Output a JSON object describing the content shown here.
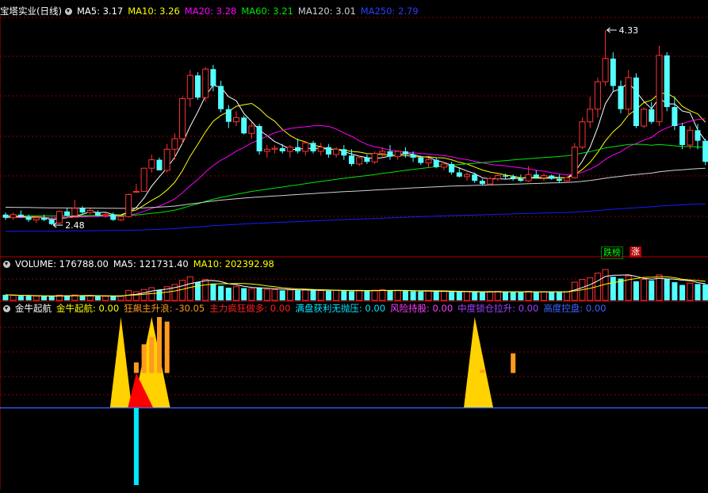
{
  "main_header": {
    "title": "宝塔实业(日线)",
    "ma5": "MA5: 3.17",
    "ma10": "MA10: 3.26",
    "ma20": "MA20: 3.28",
    "ma60": "MA60: 3.21",
    "ma120": "MA120: 3.01",
    "ma250": "MA250: 2.79"
  },
  "volume_header": {
    "title": "VOLUME: 176788.00",
    "ma5": "MA5: 121731.40",
    "ma10": "MA10: 202392.98"
  },
  "indicator_header": {
    "title": "金牛起航",
    "s1": "金牛起航: 0.00",
    "s2": "狂飙主升浪: -30.05",
    "s3": "主力疯狂做多: 0.00",
    "s4": "满盘获利无抛压: 0.00",
    "s5": "风险持股: 0.00",
    "s6": "中度锁仓拉升: 0.00",
    "s7": "高度控盘: 0.00"
  },
  "badges": {
    "drop_list": "跌榜",
    "rise": "涨"
  },
  "colors": {
    "up": "#ff3232",
    "down": "#54ffff",
    "ma5": "#ffffff",
    "ma10": "#ffff00",
    "ma20": "#ff00ff",
    "ma60": "#00e600",
    "ma120": "#d0d0d0",
    "ma250": "#1a1aff",
    "grid": "#8b0000",
    "yellow": "#ffd200",
    "red": "#ff0000",
    "orange": "#ff9a1e",
    "blue_line": "#3c64ff",
    "cyan": "#00e6ff"
  },
  "chart_data": [
    {
      "type": "candlestick",
      "title": "宝塔实业(日线)",
      "annotations": [
        {
          "label": "4.33",
          "value": 4.33
        },
        {
          "label": "2.48",
          "value": 2.48
        }
      ],
      "ylim": [
        2.36,
        4.45
      ],
      "candles": [
        [
          2.58,
          2.6,
          2.53,
          2.55
        ],
        [
          2.55,
          2.6,
          2.53,
          2.58
        ],
        [
          2.58,
          2.62,
          2.55,
          2.56
        ],
        [
          2.56,
          2.58,
          2.51,
          2.53
        ],
        [
          2.53,
          2.56,
          2.5,
          2.55
        ],
        [
          2.55,
          2.58,
          2.52,
          2.53
        ],
        [
          2.53,
          2.55,
          2.48,
          2.49
        ],
        [
          2.5,
          2.62,
          2.49,
          2.61
        ],
        [
          2.61,
          2.64,
          2.56,
          2.57
        ],
        [
          2.57,
          2.72,
          2.56,
          2.64
        ],
        [
          2.64,
          2.66,
          2.58,
          2.6
        ],
        [
          2.6,
          2.64,
          2.58,
          2.62
        ],
        [
          2.6,
          2.62,
          2.56,
          2.57
        ],
        [
          2.57,
          2.6,
          2.55,
          2.58
        ],
        [
          2.58,
          2.6,
          2.52,
          2.53
        ],
        [
          2.53,
          2.57,
          2.52,
          2.56
        ],
        [
          2.56,
          2.78,
          2.55,
          2.77
        ],
        [
          2.8,
          2.87,
          2.8,
          2.8
        ],
        [
          2.8,
          3.02,
          2.8,
          3.02
        ],
        [
          3.02,
          3.15,
          2.98,
          3.1
        ],
        [
          3.1,
          3.12,
          3.0,
          3.0
        ],
        [
          3.0,
          3.25,
          2.98,
          3.2
        ],
        [
          3.2,
          3.35,
          3.1,
          3.3
        ],
        [
          3.3,
          3.7,
          3.25,
          3.68
        ],
        [
          3.68,
          3.95,
          3.6,
          3.9
        ],
        [
          3.9,
          3.93,
          3.67,
          3.69
        ],
        [
          3.69,
          3.98,
          3.65,
          3.96
        ],
        [
          3.96,
          4.0,
          3.75,
          3.8
        ],
        [
          3.8,
          3.85,
          3.55,
          3.58
        ],
        [
          3.58,
          3.62,
          3.4,
          3.46
        ],
        [
          3.46,
          3.56,
          3.42,
          3.5
        ],
        [
          3.5,
          3.52,
          3.34,
          3.35
        ],
        [
          3.35,
          3.45,
          3.3,
          3.42
        ],
        [
          3.42,
          3.44,
          3.15,
          3.18
        ],
        [
          3.18,
          3.24,
          3.12,
          3.2
        ],
        [
          3.2,
          3.24,
          3.16,
          3.21
        ],
        [
          3.21,
          3.25,
          3.16,
          3.18
        ],
        [
          3.18,
          3.24,
          3.12,
          3.22
        ],
        [
          3.22,
          3.3,
          3.16,
          3.18
        ],
        [
          3.18,
          3.27,
          3.14,
          3.26
        ],
        [
          3.26,
          3.28,
          3.16,
          3.18
        ],
        [
          3.18,
          3.26,
          3.14,
          3.22
        ],
        [
          3.22,
          3.25,
          3.12,
          3.15
        ],
        [
          3.15,
          3.22,
          3.12,
          3.2
        ],
        [
          3.2,
          3.24,
          3.1,
          3.14
        ],
        [
          3.14,
          3.2,
          3.04,
          3.06
        ],
        [
          3.06,
          3.14,
          3.04,
          3.12
        ],
        [
          3.12,
          3.15,
          3.06,
          3.08
        ],
        [
          3.08,
          3.18,
          3.06,
          3.16
        ],
        [
          3.16,
          3.22,
          3.12,
          3.18
        ],
        [
          3.18,
          3.24,
          3.1,
          3.13
        ],
        [
          3.13,
          3.19,
          3.1,
          3.18
        ],
        [
          3.18,
          3.22,
          3.12,
          3.15
        ],
        [
          3.15,
          3.18,
          3.08,
          3.12
        ],
        [
          3.12,
          3.14,
          3.05,
          3.07
        ],
        [
          3.07,
          3.12,
          3.02,
          3.1
        ],
        [
          3.1,
          3.12,
          3.02,
          3.03
        ],
        [
          3.03,
          3.08,
          3.0,
          3.06
        ],
        [
          3.06,
          3.08,
          2.96,
          2.98
        ],
        [
          2.98,
          3.02,
          2.93,
          2.94
        ],
        [
          2.94,
          2.98,
          2.9,
          2.96
        ],
        [
          2.96,
          2.98,
          2.88,
          2.9
        ],
        [
          2.9,
          2.92,
          2.86,
          2.87
        ],
        [
          2.87,
          2.94,
          2.86,
          2.92
        ],
        [
          2.92,
          2.96,
          2.9,
          2.95
        ],
        [
          2.95,
          2.97,
          2.92,
          2.94
        ],
        [
          2.94,
          2.96,
          2.9,
          2.92
        ],
        [
          2.92,
          2.96,
          2.89,
          2.9
        ],
        [
          2.9,
          3.04,
          2.89,
          2.96
        ],
        [
          2.96,
          3.0,
          2.92,
          2.93
        ],
        [
          2.93,
          2.97,
          2.9,
          2.95
        ],
        [
          2.95,
          2.96,
          2.91,
          2.92
        ],
        [
          2.92,
          2.96,
          2.88,
          2.9
        ],
        [
          2.9,
          2.94,
          2.88,
          2.93
        ],
        [
          2.93,
          3.26,
          2.92,
          3.22
        ],
        [
          3.22,
          3.5,
          3.2,
          3.46
        ],
        [
          3.46,
          3.7,
          3.4,
          3.58
        ],
        [
          3.58,
          3.88,
          3.5,
          3.84
        ],
        [
          3.84,
          4.33,
          3.8,
          4.06
        ],
        [
          4.06,
          4.12,
          3.75,
          3.8
        ],
        [
          3.8,
          3.85,
          3.54,
          3.58
        ],
        [
          3.58,
          3.95,
          3.52,
          3.88
        ],
        [
          3.88,
          3.92,
          3.4,
          3.42
        ],
        [
          3.42,
          3.6,
          3.4,
          3.58
        ],
        [
          3.58,
          3.65,
          3.44,
          3.46
        ],
        [
          3.46,
          4.18,
          3.42,
          4.09
        ],
        [
          4.09,
          4.12,
          3.56,
          3.6
        ],
        [
          3.6,
          3.7,
          3.38,
          3.42
        ],
        [
          3.42,
          3.45,
          3.2,
          3.24
        ],
        [
          3.24,
          3.42,
          3.2,
          3.38
        ],
        [
          3.38,
          3.44,
          3.2,
          3.28
        ],
        [
          3.28,
          3.3,
          3.05,
          3.08
        ]
      ],
      "volume": [
        62,
        55,
        50,
        48,
        46,
        44,
        42,
        58,
        54,
        60,
        52,
        48,
        46,
        45,
        44,
        47,
        110,
        95,
        120,
        140,
        115,
        150,
        175,
        220,
        260,
        200,
        230,
        185,
        160,
        140,
        150,
        135,
        128,
        140,
        120,
        118,
        110,
        115,
        112,
        118,
        110,
        108,
        105,
        112,
        108,
        100,
        110,
        104,
        112,
        118,
        106,
        110,
        104,
        100,
        98,
        104,
        96,
        100,
        94,
        92,
        96,
        90,
        88,
        98,
        100,
        94,
        92,
        90,
        100,
        96,
        94,
        92,
        90,
        94,
        200,
        230,
        250,
        300,
        340,
        260,
        240,
        270,
        210,
        230,
        220,
        280,
        240,
        200,
        170,
        190,
        180,
        176.788
      ],
      "ylim_volume": [
        0,
        340
      ]
    },
    {
      "type": "bar",
      "title": "金牛起航",
      "series": [
        "金牛起航",
        "狂飙主升浪",
        "主力疯狂做多",
        "满盘获利无抛压",
        "风险持股",
        "中度锁仓拉升",
        "高度控盘"
      ],
      "ylim": [
        -85,
        100
      ],
      "yellow_triangle": [
        {
          "from": 14,
          "peak": 15,
          "to": 16
        },
        {
          "from": 17,
          "peak": 19,
          "to": 21
        },
        {
          "from": 60,
          "peak": 61,
          "to": 63
        }
      ],
      "red_triangle": [
        {
          "from": 16,
          "peak": 17,
          "to": 19
        }
      ],
      "orange_bars": [
        {
          "i": 17,
          "top": 50
        },
        {
          "i": 18,
          "top": 70
        },
        {
          "i": 19,
          "top": 78
        },
        {
          "i": 20,
          "top": 100
        },
        {
          "i": 21,
          "top": 95
        },
        {
          "i": 62,
          "top": 42
        },
        {
          "i": 66,
          "top": 60
        }
      ],
      "cyan_bar": {
        "i": 17,
        "value": -85
      }
    }
  ]
}
